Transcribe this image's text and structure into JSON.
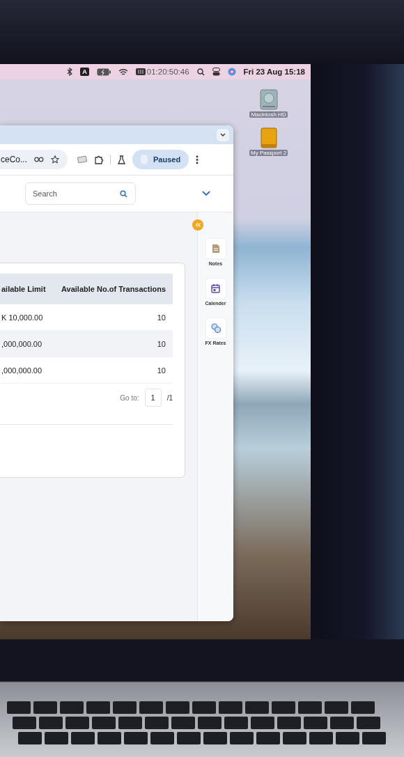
{
  "menu_bar": {
    "timer": "01:20:50:46",
    "clock": "Fri 23 Aug 15:18",
    "input_badge": "A"
  },
  "desktop_icons": [
    {
      "label": "Macintosh HD",
      "kind": "drive"
    },
    {
      "label": "My Passport 2",
      "kind": "external"
    }
  ],
  "browser": {
    "address_fragment": "ceCo...",
    "profile_button": "Paused"
  },
  "app_header": {
    "search_placeholder": "Search"
  },
  "table": {
    "columns": [
      "ailable Limit",
      "Available No.of Transactions"
    ],
    "rows": [
      [
        "K 10,000.00",
        "10"
      ],
      [
        ",000,000.00",
        "10"
      ],
      [
        ",000,000.00",
        "10"
      ]
    ]
  },
  "pager": {
    "label": "Go to:",
    "page": "1",
    "total": "/1"
  },
  "side_panel": [
    {
      "label": "Notes",
      "kind": "notes"
    },
    {
      "label": "Calender",
      "kind": "calendar"
    },
    {
      "label": "FX Rates",
      "kind": "fx"
    }
  ]
}
